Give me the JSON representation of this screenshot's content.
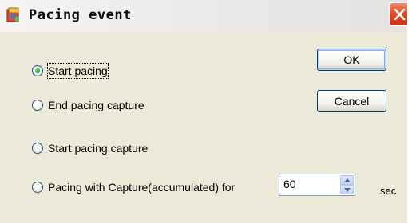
{
  "window": {
    "title": "Pacing event",
    "icon": "app-icon",
    "close_icon": "close-icon"
  },
  "options": [
    {
      "label": "Start pacing",
      "checked": true
    },
    {
      "label": "End pacing capture",
      "checked": false
    },
    {
      "label": "Start pacing capture",
      "checked": false
    },
    {
      "label": "Pacing with Capture(accumulated) for",
      "checked": false
    }
  ],
  "buttons": {
    "ok_label": "OK",
    "cancel_label": "Cancel"
  },
  "duration": {
    "value": "60",
    "unit": "sec"
  },
  "colors": {
    "close_button": "#e04c24",
    "selected_radio": "#21a121",
    "dialog_bg": "#ece9d8"
  }
}
